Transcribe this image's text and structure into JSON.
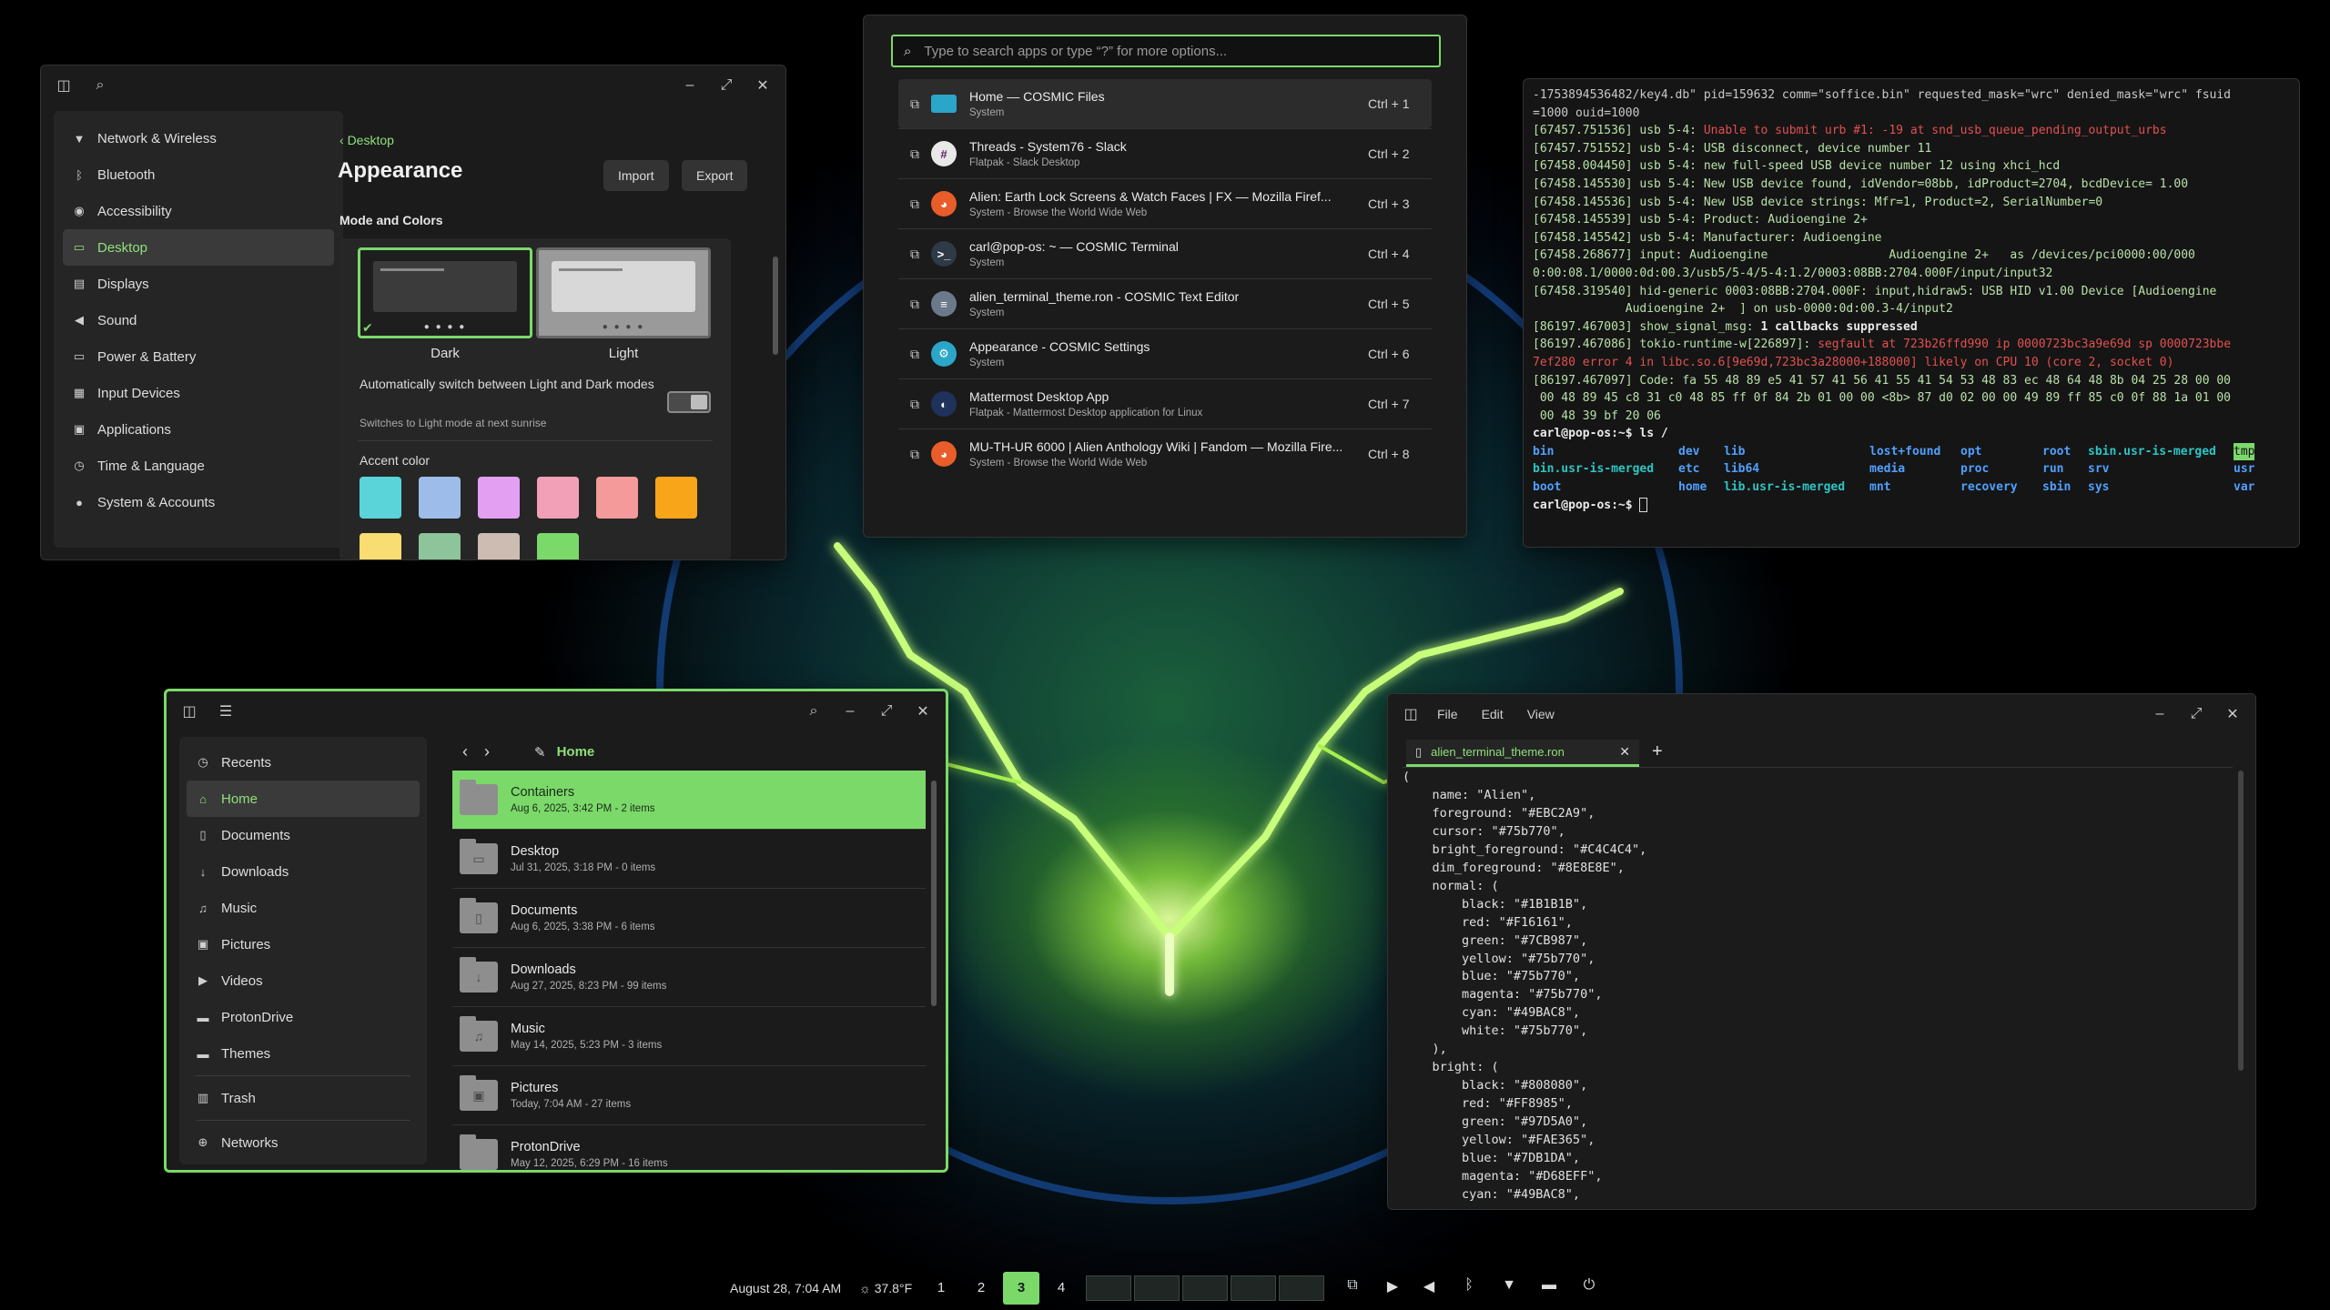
{
  "settings": {
    "sidebar": [
      {
        "label": "Network & Wireless",
        "icon": "wifi-icon",
        "glyph": "▼"
      },
      {
        "label": "Bluetooth",
        "icon": "bluetooth-icon",
        "glyph": "ᛒ"
      },
      {
        "label": "Accessibility",
        "icon": "accessibility-icon",
        "glyph": "◉"
      },
      {
        "label": "Desktop",
        "icon": "desktop-icon",
        "glyph": "▭",
        "active": true
      },
      {
        "label": "Displays",
        "icon": "displays-icon",
        "glyph": "▤"
      },
      {
        "label": "Sound",
        "icon": "sound-icon",
        "glyph": "◀"
      },
      {
        "label": "Power & Battery",
        "icon": "battery-icon",
        "glyph": "▭"
      },
      {
        "label": "Input Devices",
        "icon": "keyboard-icon",
        "glyph": "▦"
      },
      {
        "label": "Applications",
        "icon": "applications-icon",
        "glyph": "▣"
      },
      {
        "label": "Time & Language",
        "icon": "clock-icon",
        "glyph": "◷"
      },
      {
        "label": "System & Accounts",
        "icon": "accounts-icon",
        "glyph": "●"
      }
    ],
    "breadcrumb": "Desktop",
    "title": "Appearance",
    "import_label": "Import",
    "export_label": "Export",
    "section": "Mode and Colors",
    "dark_label": "Dark",
    "light_label": "Light",
    "auto_switch": "Automatically switch between Light and Dark modes",
    "auto_switch_sub": "Switches to Light mode at next sunrise",
    "accent_label": "Accent color",
    "accent_colors": [
      "#5ad3d9",
      "#9dbcea",
      "#e3a0f2",
      "#f2a0b8",
      "#f59a9a",
      "#f8a51a",
      "#f7dd72",
      "#8dc49a",
      "#cdbcb2",
      "#7bd96a"
    ]
  },
  "launcher": {
    "placeholder": "Type to search apps or type “?” for more options...",
    "items": [
      {
        "name": "Home — COSMIC Files",
        "sub": "System",
        "key": "Ctrl + 1",
        "icon": "files-app-icon",
        "color": "#2aa6c8",
        "glyph": ""
      },
      {
        "name": "Threads - System76 - Slack",
        "sub": "Flatpak - Slack Desktop",
        "key": "Ctrl + 2",
        "icon": "slack-app-icon",
        "color": "#e8e8e8",
        "glyph": "#"
      },
      {
        "name": "Alien: Earth Lock Screens & Watch Faces | FX — Mozilla Firef...",
        "sub": "System - Browse the World Wide Web",
        "key": "Ctrl + 3",
        "icon": "firefox-app-icon",
        "color": "#e85d2a",
        "glyph": "◕"
      },
      {
        "name": "carl@pop-os: ~ — COSMIC Terminal",
        "sub": "System",
        "key": "Ctrl + 4",
        "icon": "terminal-app-icon",
        "color": "#2e3a46",
        "glyph": ">_"
      },
      {
        "name": "alien_terminal_theme.ron - COSMIC Text Editor",
        "sub": "System",
        "key": "Ctrl + 5",
        "icon": "text-editor-app-icon",
        "color": "#6a7a8a",
        "glyph": "≡"
      },
      {
        "name": "Appearance - COSMIC Settings",
        "sub": "System",
        "key": "Ctrl + 6",
        "icon": "settings-app-icon",
        "color": "#2aa6c8",
        "glyph": "⚙"
      },
      {
        "name": "Mattermost Desktop App",
        "sub": "Flatpak - Mattermost Desktop application for Linux",
        "key": "Ctrl + 7",
        "icon": "mattermost-app-icon",
        "color": "#1e325c",
        "glyph": "◐"
      },
      {
        "name": "MU-TH-UR 6000 | Alien Anthology Wiki | Fandom — Mozilla Fire...",
        "sub": "System - Browse the World Wide Web",
        "key": "Ctrl + 8",
        "icon": "firefox-app-icon",
        "color": "#e85d2a",
        "glyph": "◕"
      }
    ]
  },
  "terminal": {
    "lines": [
      {
        "cls": "",
        "text": "-1753894536482/key4.db\" pid=159632 comm=\"soffice.bin\" requested_mask=\"wrc\" denied_mask=\"wrc\" fsuid"
      },
      {
        "cls": "",
        "text": "=1000 ouid=1000"
      },
      {
        "cls": "t-green",
        "text": "[67457.751536] usb 5-4: ",
        "tail_cls": "t-red",
        "tail": "Unable to submit urb #1: -19 at snd_usb_queue_pending_output_urbs"
      },
      {
        "cls": "t-green",
        "text": "[67457.751552] usb 5-4: USB disconnect, device number 11"
      },
      {
        "cls": "t-green",
        "text": "[67458.004450] usb 5-4: new full-speed USB device number 12 using xhci_hcd"
      },
      {
        "cls": "t-green",
        "text": "[67458.145530] usb 5-4: New USB device found, idVendor=08bb, idProduct=2704, bcdDevice= 1.00"
      },
      {
        "cls": "t-green",
        "text": "[67458.145536] usb 5-4: New USB device strings: Mfr=1, Product=2, SerialNumber=0"
      },
      {
        "cls": "t-green",
        "text": "[67458.145539] usb 5-4: Product: Audioengine 2+"
      },
      {
        "cls": "t-green",
        "text": "[67458.145542] usb 5-4: Manufacturer: Audioengine"
      },
      {
        "cls": "t-green",
        "text": "[67458.268677] input: Audioengine                 Audioengine 2+   as /devices/pci0000:00/000"
      },
      {
        "cls": "t-green",
        "text": "0:00:08.1/0000:0d:00.3/usb5/5-4/5-4:1.2/0003:08BB:2704.000F/input/input32"
      },
      {
        "cls": "t-green",
        "text": "[67458.319540] hid-generic 0003:08BB:2704.000F: input,hidraw5: USB HID v1.00 Device [Audioengine"
      },
      {
        "cls": "t-green",
        "text": "             Audioengine 2+  ] on usb-0000:0d:00.3-4/input2"
      },
      {
        "cls": "t-green",
        "text": "[86197.467003] show_signal_msg: ",
        "tail_cls": "t-bold",
        "tail": "1 callbacks suppressed"
      },
      {
        "cls": "t-green",
        "text": "[86197.467086] tokio-runtime-w[226897]: ",
        "tail_cls": "t-red",
        "tail": "segfault at 723b26ffd990 ip 0000723bc3a9e69d sp 0000723bbe"
      },
      {
        "cls": "t-red",
        "text": "7ef280 error 4 in libc.so.6[9e69d,723bc3a28000+188000] likely on CPU 10 (core 2, socket 0)"
      },
      {
        "cls": "t-green",
        "text": "[86197.467097] Code: fa 55 48 89 e5 41 57 41 56 41 55 41 54 53 48 83 ec 48 64 48 8b 04 25 28 00 00"
      },
      {
        "cls": "t-green",
        "text": " 00 48 89 45 c8 31 c0 48 85 ff 0f 84 2b 01 00 00 <8b> 87 d0 02 00 00 49 89 ff 85 c0 0f 88 1a 01 00"
      },
      {
        "cls": "t-green",
        "text": " 00 48 39 bf 20 06"
      }
    ],
    "prompt1": "carl@pop-os:~$ ls /",
    "ls_rows": [
      [
        "bin",
        "dev",
        "lib",
        "lost+found",
        "opt",
        "root",
        "sbin.usr-is-merged",
        "tmp"
      ],
      [
        "bin.usr-is-merged",
        "etc",
        "lib64",
        "media",
        "proc",
        "run",
        "srv",
        "usr"
      ],
      [
        "boot",
        "home",
        "lib.usr-is-merged",
        "mnt",
        "recovery",
        "sbin",
        "sys",
        "var"
      ]
    ],
    "prompt2": "carl@pop-os:~$ "
  },
  "files": {
    "sidebar": [
      {
        "label": "Recents",
        "icon": "clock-icon",
        "glyph": "◷"
      },
      {
        "label": "Home",
        "icon": "home-icon",
        "glyph": "⌂",
        "active": true
      },
      {
        "label": "Documents",
        "icon": "document-icon",
        "glyph": "▯"
      },
      {
        "label": "Downloads",
        "icon": "download-icon",
        "glyph": "↓"
      },
      {
        "label": "Music",
        "icon": "music-icon",
        "glyph": "♫"
      },
      {
        "label": "Pictures",
        "icon": "picture-icon",
        "glyph": "▣"
      },
      {
        "label": "Videos",
        "icon": "video-icon",
        "glyph": "▶"
      },
      {
        "label": "ProtonDrive",
        "icon": "folder-icon",
        "glyph": "▬"
      },
      {
        "label": "Themes",
        "icon": "folder-icon",
        "glyph": "▬"
      }
    ],
    "trash": "Trash",
    "networks": "Networks",
    "path": "Home",
    "rows": [
      {
        "name": "Containers",
        "meta": "Aug 6, 2025, 3:42 PM - 2 items",
        "glyph": ""
      },
      {
        "name": "Desktop",
        "meta": "Jul 31, 2025, 3:18 PM - 0 items",
        "glyph": "▭"
      },
      {
        "name": "Documents",
        "meta": "Aug 6, 2025, 3:38 PM - 6 items",
        "glyph": "▯"
      },
      {
        "name": "Downloads",
        "meta": "Aug 27, 2025, 8:23 PM - 99 items",
        "glyph": "↓"
      },
      {
        "name": "Music",
        "meta": "May 14, 2025, 5:23 PM - 3 items",
        "glyph": "♫"
      },
      {
        "name": "Pictures",
        "meta": "Today, 7:04 AM - 27 items",
        "glyph": "▣"
      },
      {
        "name": "ProtonDrive",
        "meta": "May 12, 2025, 6:29 PM - 16 items",
        "glyph": ""
      }
    ]
  },
  "editor": {
    "menu": [
      "File",
      "Edit",
      "View"
    ],
    "tab": "alien_terminal_theme.ron",
    "code": [
      "(",
      "    name: \"Alien\",",
      "    foreground: \"#EBC2A9\",",
      "    cursor: \"#75b770\",",
      "    bright_foreground: \"#C4C4C4\",",
      "    dim_foreground: \"#8E8E8E\",",
      "    normal: (",
      "        black: \"#1B1B1B\",",
      "        red: \"#F16161\",",
      "        green: \"#7CB987\",",
      "        yellow: \"#75b770\",",
      "        blue: \"#75b770\",",
      "        magenta: \"#75b770\",",
      "        cyan: \"#49BAC8\",",
      "        white: \"#75b770\",",
      "    ),",
      "    bright: (",
      "        black: \"#808080\",",
      "        red: \"#FF8985\",",
      "        green: \"#97D5A0\",",
      "        yellow: \"#FAE365\",",
      "        blue: \"#7DB1DA\",",
      "        magenta: \"#D68EFF\",",
      "        cyan: \"#49BAC8\","
    ]
  },
  "panel": {
    "datetime": "August 28, 7:04 AM",
    "weather": "☼ 37.8°F",
    "workspaces": [
      "1",
      "2",
      "3",
      "4"
    ],
    "active_workspace": "3"
  }
}
